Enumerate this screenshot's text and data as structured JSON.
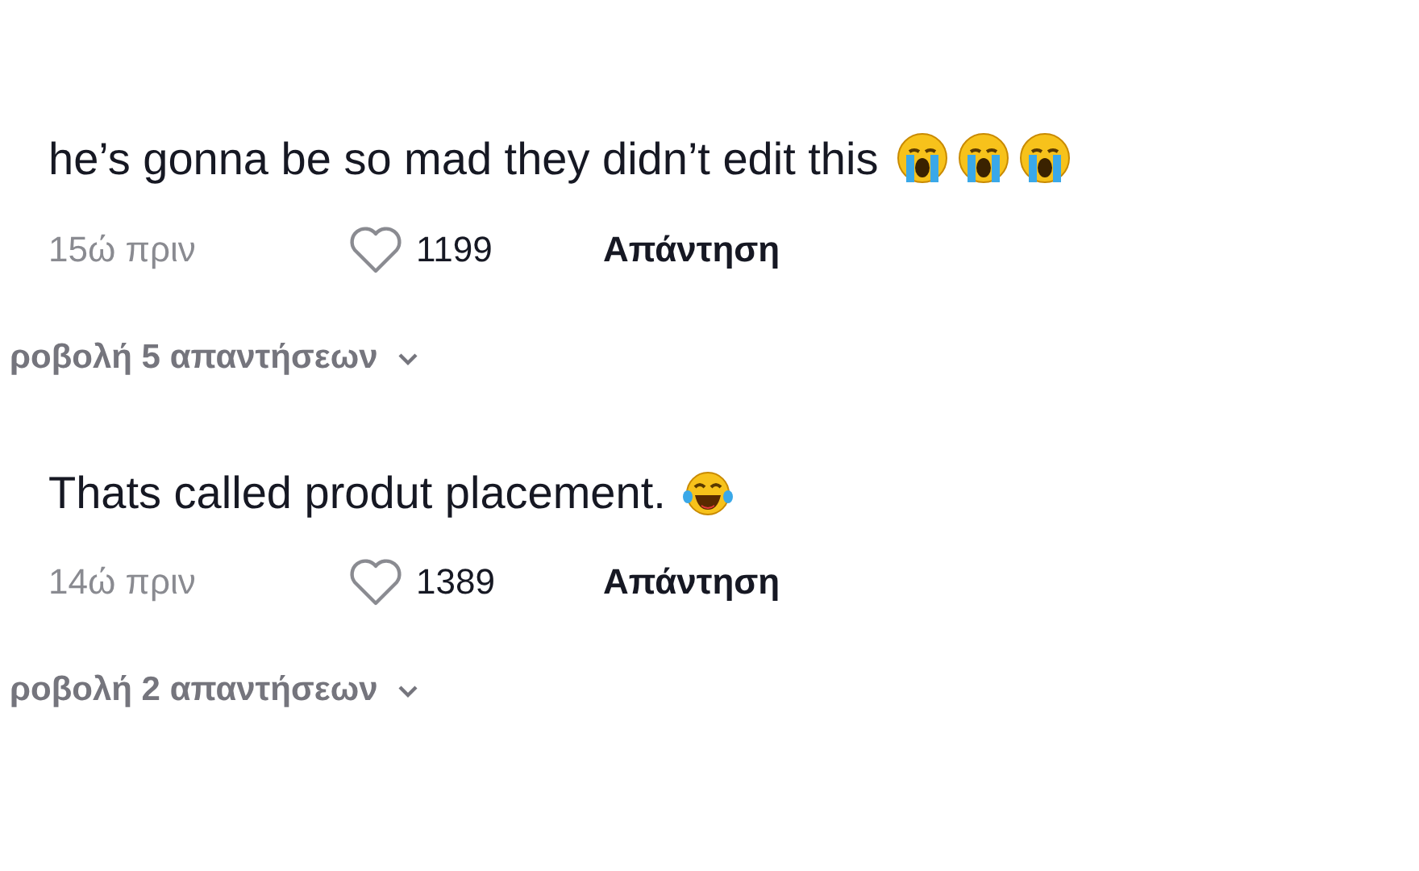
{
  "comments": [
    {
      "text": "he’s gonna be so mad they didn’t edit this",
      "emojis": [
        {
          "kind": "loudly-crying"
        },
        {
          "kind": "loudly-crying"
        },
        {
          "kind": "loudly-crying"
        }
      ],
      "time": "15ώ πριν",
      "likes": "1199",
      "reply": "Απάντηση",
      "view_replies": "ροβολή 5 απαντήσεων"
    },
    {
      "text": "Thats called produt placement.",
      "emojis": [
        {
          "kind": "tears-of-joy"
        }
      ],
      "time": "14ώ πριν",
      "likes": "1389",
      "reply": "Απάντηση",
      "view_replies": "ροβολή 2 απαντήσεων"
    }
  ]
}
